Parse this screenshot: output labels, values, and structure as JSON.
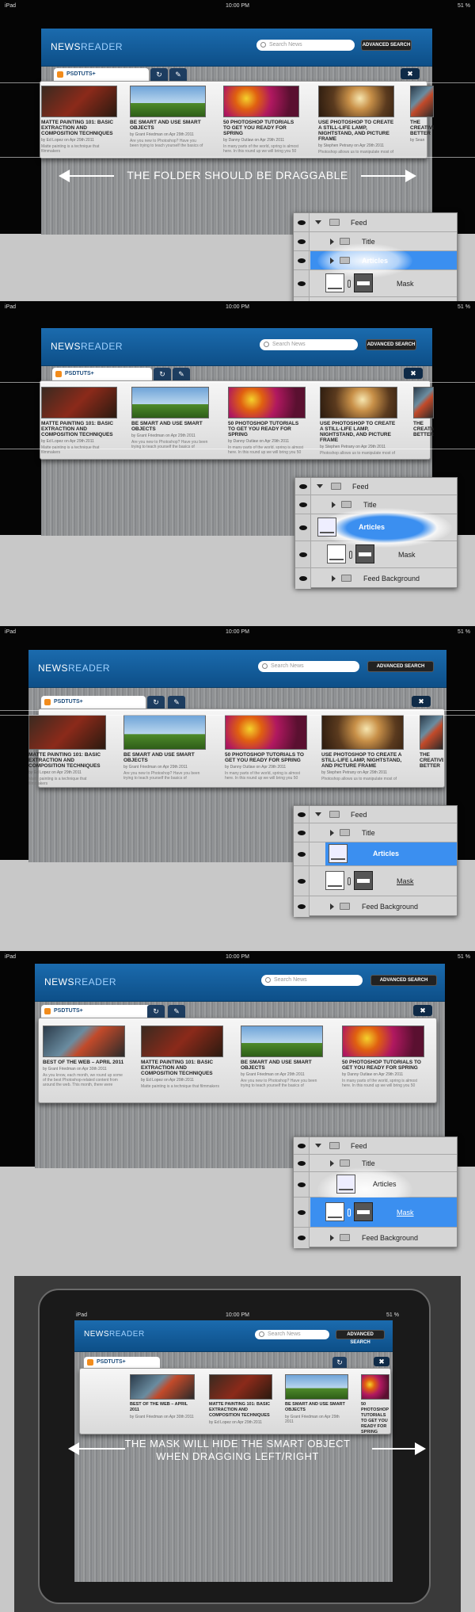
{
  "status": {
    "device": "iPad",
    "time": "10:00 PM",
    "battery": "51 %"
  },
  "app": {
    "logo_a": "NEWS",
    "logo_b": "READER",
    "search_placeholder": "Search News",
    "advanced": "ADVANCED SEARCH"
  },
  "folder": {
    "tab": "PSDTUTS+",
    "refresh": "↻",
    "tools": "✎",
    "close": "✖"
  },
  "articles": [
    {
      "title": "MATTE PAINTING 101: BASIC EXTRACTION AND COMPOSITION TECHNIQUES",
      "by": "by Ed Lopez on Apr 29th 2011",
      "desc": "Matte painting is a technique that filmmakers"
    },
    {
      "title": "BE SMART AND USE SMART OBJECTS",
      "by": "by Grant Friedman on Apr 29th 2011",
      "desc": "Are you new to Photoshop? Have you been trying to teach yourself the basics of"
    },
    {
      "title": "50 PHOTOSHOP TUTORIALS TO GET YOU READY FOR SPRING",
      "by": "by Danny Outlaw on Apr 29th 2011",
      "desc": "In many parts of the world, spring is almost here. In this round up we will bring you 50"
    },
    {
      "title": "USE PHOTOSHOP TO CREATE A STILL-LIFE LAMP, NIGHTSTAND, AND PICTURE FRAME",
      "by": "by Stephen Petrany on Apr 29th 2011",
      "desc": "Photoshop allows us to manipulate most of"
    },
    {
      "title": "THE CREATIVE BETTER",
      "by": "by Sean",
      "desc": ""
    },
    {
      "title": "BEST OF THE WEB – APRIL 2011",
      "by": "by Grant Friedman on Apr 30th 2011",
      "desc": "As you know, each month, we round up some of the best Photoshop-related content from around the web. This month, there were"
    }
  ],
  "captions": {
    "drag": "THE FOLDER SHOULD BE DRAGGABLE",
    "mask_1": "THE MASK WILL HIDE THE SMART OBJECT",
    "mask_2": "WHEN DRAGGING LEFT/RIGHT"
  },
  "layers": {
    "feed": "Feed",
    "title": "Title",
    "articles": "Articles",
    "mask": "Mask",
    "feed_bg": "Feed Background"
  },
  "colors": {
    "nav_blue": "#1b6bae",
    "select_blue": "#3b8ff0",
    "rss_orange": "#f28c1c"
  }
}
